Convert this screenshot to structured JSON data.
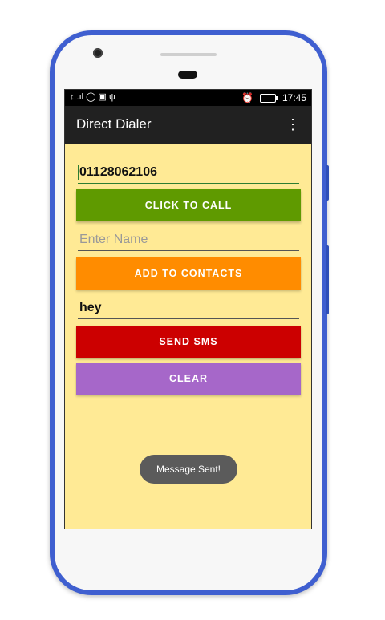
{
  "statusbar": {
    "left_icons": "↕ .ıl ◯ ▣ ψ",
    "alarm_icon": "⏰",
    "time": "17:45"
  },
  "app": {
    "title": "Direct Dialer",
    "menu_icon": "more-vert-icon"
  },
  "phone_field": {
    "value": "01128062106"
  },
  "call_button": {
    "label": "CLICK TO CALL",
    "color": "#5f9a00"
  },
  "name_field": {
    "placeholder": "Enter Name"
  },
  "contacts_button": {
    "label": "ADD TO CONTACTS",
    "color": "#ff8c00"
  },
  "message_field": {
    "value": "hey"
  },
  "sms_button": {
    "label": "SEND SMS",
    "color": "#cc0000"
  },
  "clear_button": {
    "label": "CLEAR",
    "color": "#a667c9"
  },
  "toast": {
    "text": "Message Sent!"
  },
  "colors": {
    "screen_bg": "#ffea95",
    "appbar_bg": "#212121",
    "phone_frame": "#3f5fd0"
  }
}
